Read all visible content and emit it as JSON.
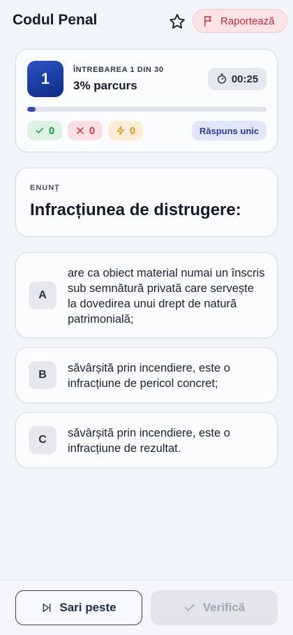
{
  "header": {
    "title": "Codul Penal",
    "favorite_icon": "star-icon",
    "report_label": "Raportează",
    "report_icon": "flag-icon"
  },
  "progress": {
    "question_number": "1",
    "question_label": "ÎNTREBAREA 1 DIN 30",
    "progress_text": "3% parcurs",
    "progress_fraction": 0.03,
    "timer": "00:25",
    "correct_count": "0",
    "wrong_count": "0",
    "skipped_count": "0",
    "mode": "Răspuns unic"
  },
  "statement": {
    "label": "ENUNȚ",
    "text": "Infracțiunea de distrugere:"
  },
  "options": [
    {
      "letter": "A",
      "text": "are ca obiect material numai un înscris sub semnătură privată care servește la dovedirea unui drept de natură patrimonială;"
    },
    {
      "letter": "B",
      "text": "săvârșită prin incendiere, este o infracțiune de pericol concret;"
    },
    {
      "letter": "C",
      "text": "săvârșită prin incendiere, este o infracțiune de rezultat."
    }
  ],
  "footer": {
    "skip_label": "Sari peste",
    "verify_label": "Verifică"
  },
  "colors": {
    "accent": "#1f3fa8",
    "report": "#c72c3a",
    "correct": "#22914d",
    "wrong": "#d2394a",
    "skipped": "#d8921a"
  }
}
